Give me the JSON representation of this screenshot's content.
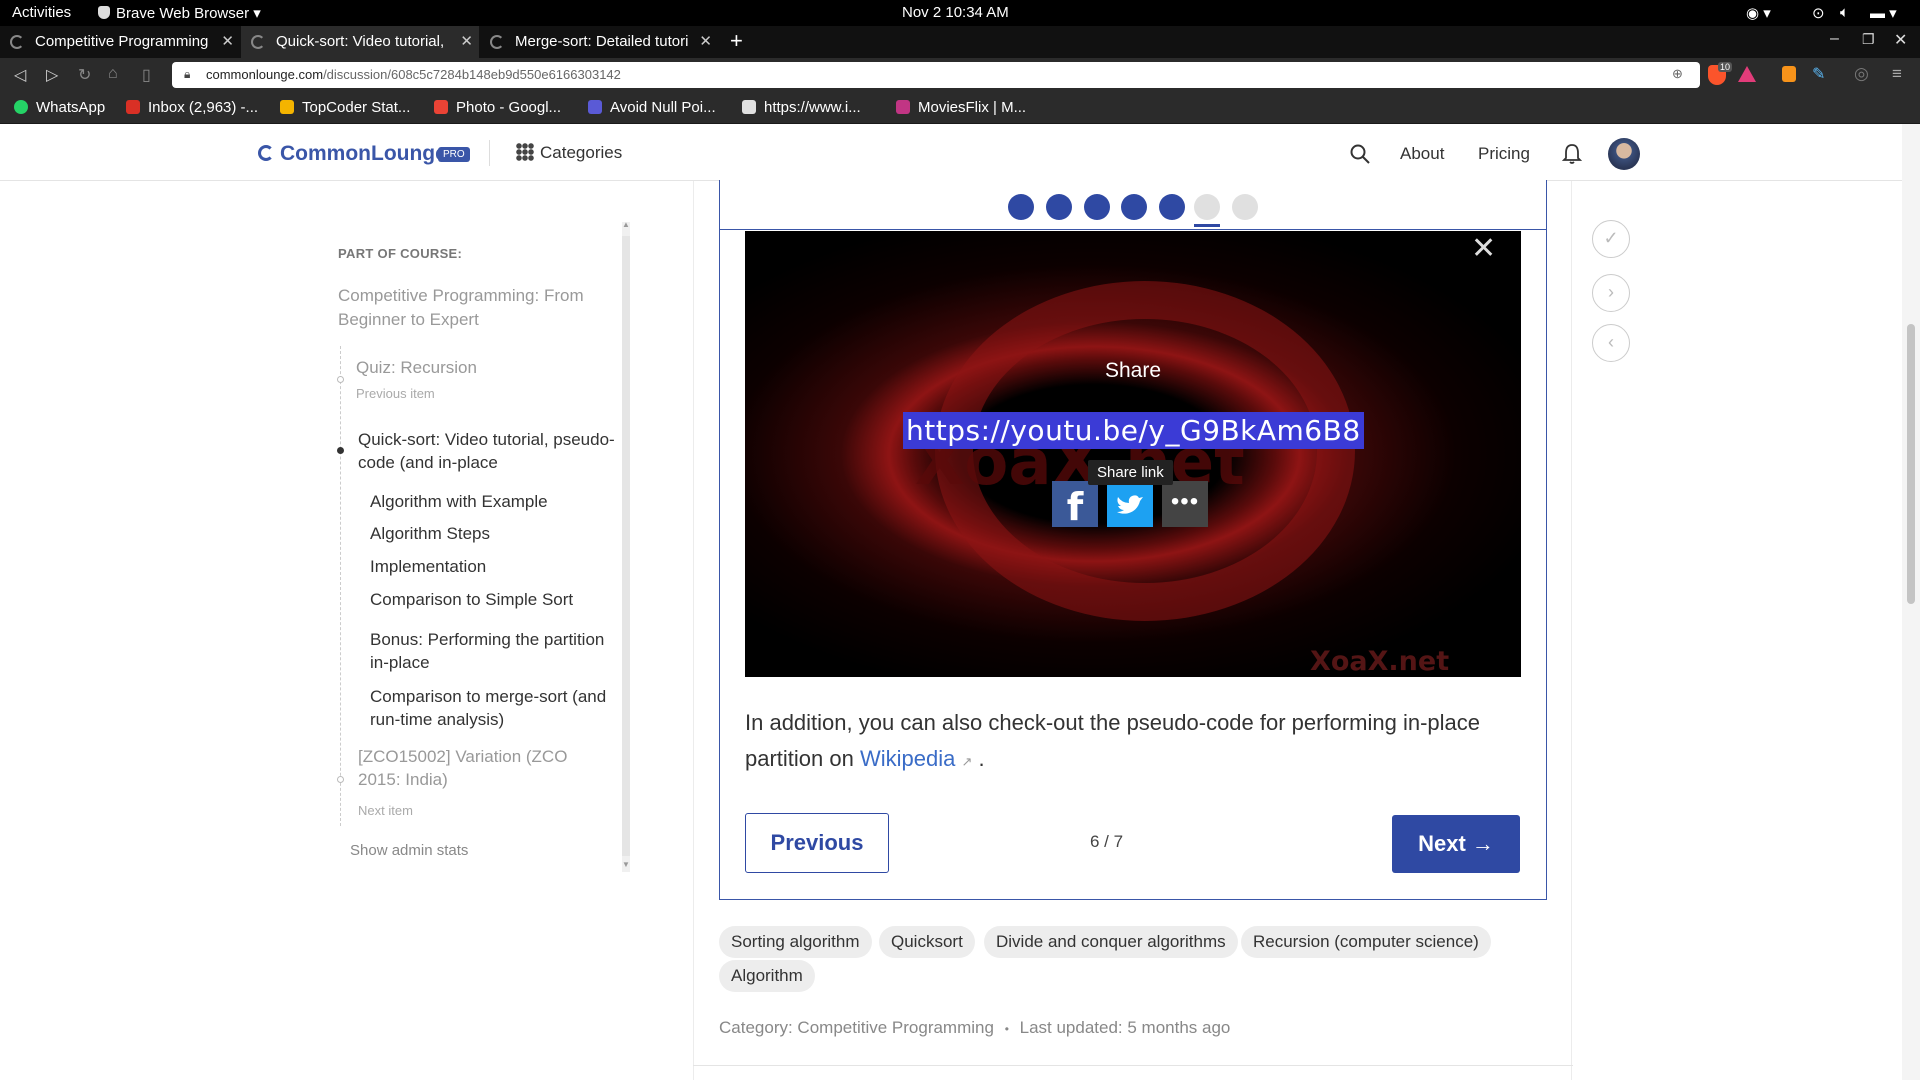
{
  "system": {
    "activities": "Activities",
    "app_name": "Brave Web Browser",
    "clock": "Nov 2  10:34 AM"
  },
  "tabs": [
    {
      "label": "Competitive Programming"
    },
    {
      "label": "Quick-sort: Video tutorial,"
    },
    {
      "label": "Merge-sort: Detailed tutori"
    }
  ],
  "address": {
    "domain": "commonlounge.com",
    "path": "/discussion/608c5c7284b148eb9d550e6166303142",
    "shield_count": "10"
  },
  "bookmarks": [
    {
      "label": "WhatsApp",
      "color": "#25d366"
    },
    {
      "label": "Inbox (2,963) -...",
      "color": "#d93025"
    },
    {
      "label": "TopCoder Stat...",
      "color": "#f4b400"
    },
    {
      "label": "Photo - Googl...",
      "color": "#ea4335"
    },
    {
      "label": "Avoid Null Poi...",
      "color": "#5a5ad6"
    },
    {
      "label": "https://www.i...",
      "color": "#e0e0e0"
    },
    {
      "label": "MoviesFlix | M...",
      "color": "#c13584"
    }
  ],
  "site": {
    "logo": "CommonLounge",
    "pro_badge": "PRO",
    "categories": "Categories",
    "about": "About",
    "pricing": "Pricing"
  },
  "sidebar": {
    "part_of": "PART OF COURSE:",
    "course_title": "Competitive Programming: From Beginner to Expert",
    "previous_title": "Quiz: Recursion",
    "previous_label": "Previous item",
    "current_title": "Quick-sort: Video tutorial, pseudo-code (and in-place",
    "sections": [
      "Algorithm with Example",
      "Algorithm Steps",
      "Implementation",
      "Comparison to Simple Sort",
      "Bonus: Performing the partition in-place",
      "Comparison to merge-sort (and run-time analysis)"
    ],
    "next_title": "[ZCO15002] Variation (ZCO 2015: India)",
    "next_label": "Next item",
    "admin": "Show admin stats"
  },
  "progress": {
    "completed": 5,
    "current": 6,
    "total": 7
  },
  "video": {
    "share_title": "Share",
    "share_link": "https://youtu.be/y_G9BkAm6B8",
    "tooltip": "Share link",
    "watermark": "XoaX.net"
  },
  "content": {
    "text_before": "In addition, you can also check-out the pseudo-code for performing in-place partition on ",
    "link": "Wikipedia",
    "text_after": " ."
  },
  "nav": {
    "previous": "Previous",
    "counter": "6 / 7",
    "next": "Next →"
  },
  "tags": [
    "Sorting algorithm",
    "Quicksort",
    "Divide and conquer algorithms",
    "Recursion (computer science)",
    "Algorithm"
  ],
  "meta": {
    "category": "Category: Competitive Programming",
    "updated": "Last updated: 5 months ago"
  },
  "colors": {
    "accent": "#2f49a3",
    "brand": "#3a56a8",
    "link": "#3a6cc7"
  }
}
